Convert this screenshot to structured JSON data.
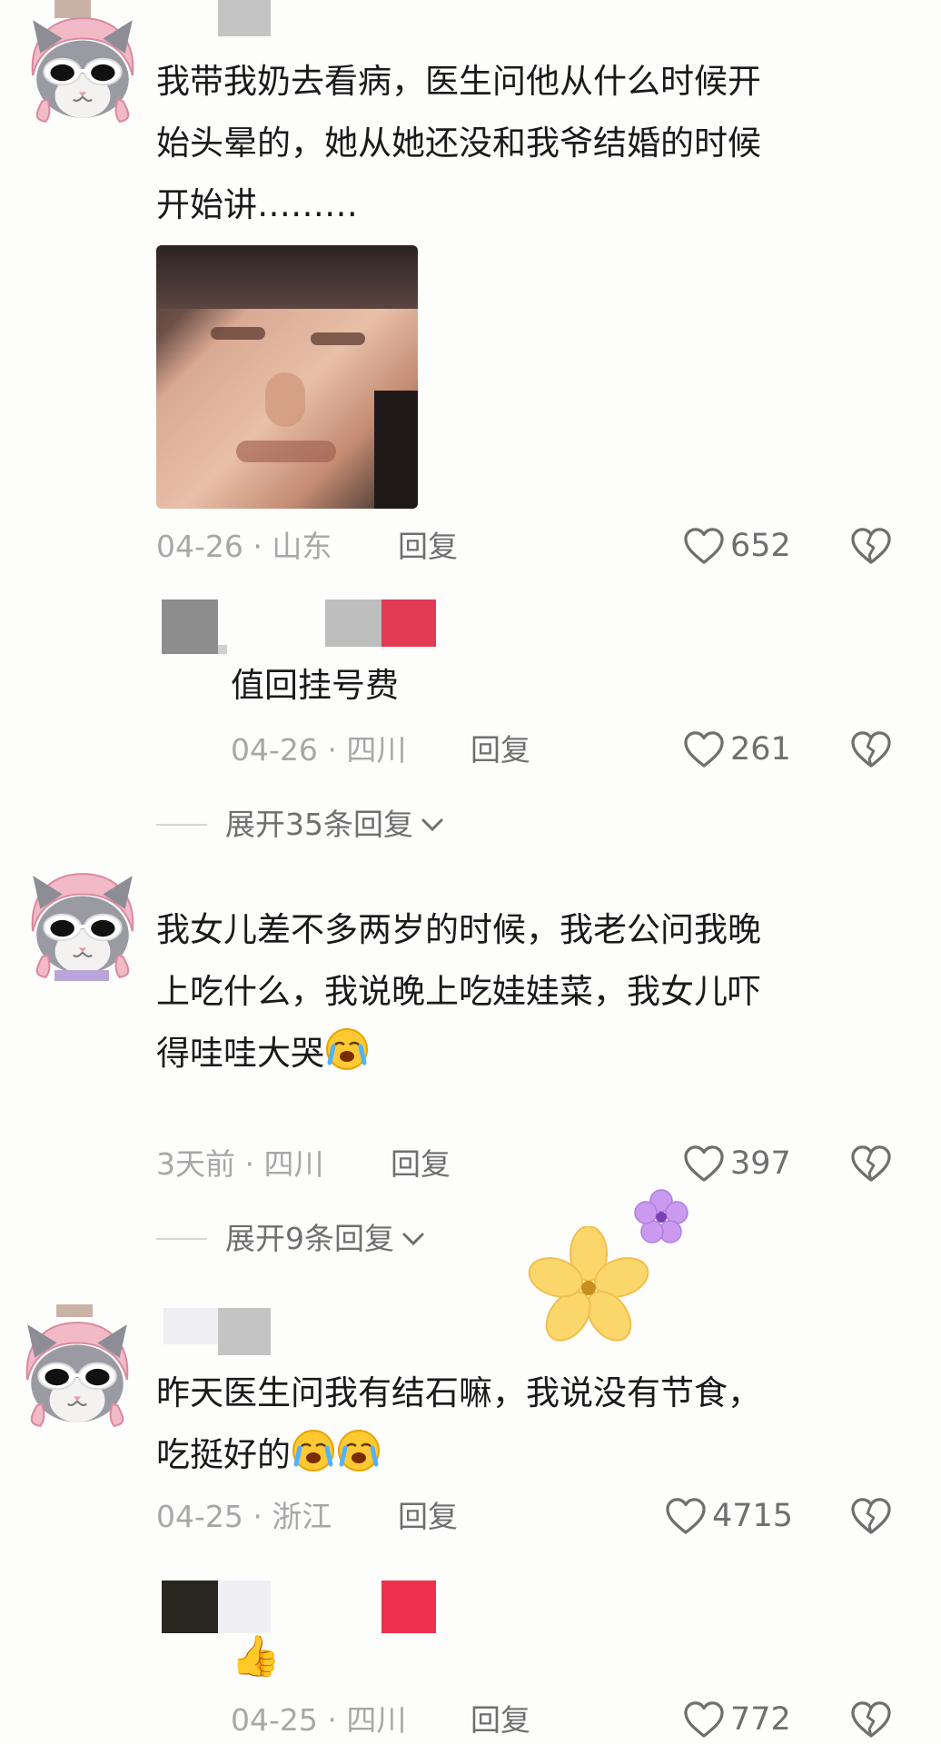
{
  "comments": [
    {
      "text": "我带我奶去看病，医生问他从什么时候开始头晕的，她从她还没和我爷结婚的时候开始讲………",
      "line1": "我带我奶去看病，医生问他从什么时候开",
      "line2": "始头晕的，她从她还没和我爷结婚的时候",
      "line3": "开始讲………",
      "date_location": "04-26 · 山东",
      "reply_label": "回复",
      "likes": "652",
      "reply": {
        "text": "值回挂号费",
        "date_location": "04-26 · 四川",
        "reply_label": "回复",
        "likes": "261"
      },
      "expand_label": "展开35条回复"
    },
    {
      "line1": "我女儿差不多两岁的时候，我老公问我晚",
      "line2": "上吃什么，我说晚上吃娃娃菜，我女儿吓",
      "line3": "得哇哇大哭",
      "date_location": "3天前 · 四川",
      "reply_label": "回复",
      "likes": "397",
      "expand_label": "展开9条回复"
    },
    {
      "line1": "昨天医生问我有结石嘛，我说没有节食，",
      "line2": "吃挺好的",
      "date_location": "04-25 · 浙江",
      "reply_label": "回复",
      "likes": "4715",
      "reply": {
        "date_location": "04-25 · 四川",
        "reply_label": "回复",
        "likes": "772"
      }
    }
  ],
  "icons": {
    "like": "heart-outline-icon",
    "dislike": "broken-heart-icon",
    "expand": "chevron-down-icon"
  },
  "colors": {
    "text": "#1a1a1a",
    "meta": "#a7a7a7",
    "action": "#6f6f6f",
    "accent_red": "#e23a54"
  }
}
